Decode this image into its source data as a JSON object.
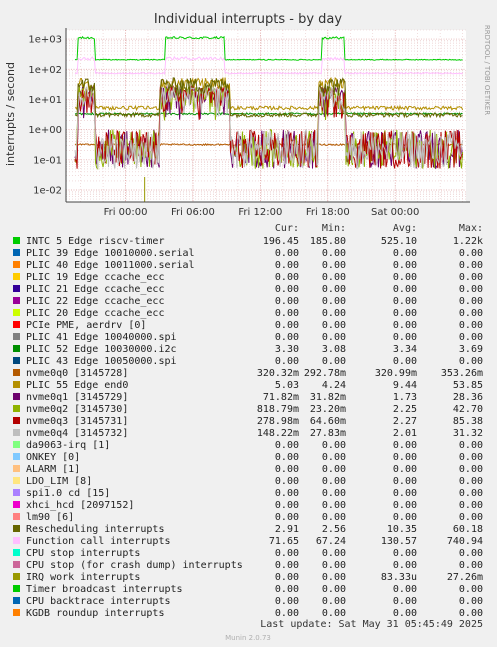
{
  "chart_data": {
    "type": "line",
    "title": "Individual interrupts - by day",
    "ylabel": "interrupts / second",
    "y_scale": "log",
    "ylim": [
      0.004,
      2000
    ],
    "y_ticks": [
      {
        "value": 1000,
        "label": "1e+03"
      },
      {
        "value": 100,
        "label": "1e+02"
      },
      {
        "value": 10,
        "label": "1e+01"
      },
      {
        "value": 1,
        "label": "1e+00"
      },
      {
        "value": 0.1,
        "label": "1e-01"
      },
      {
        "value": 0.01,
        "label": "1e-02"
      }
    ],
    "x_range_hours": [
      -5.3,
      30.3
    ],
    "x_ticks": [
      {
        "hour": 0,
        "label": "Fri 00:00"
      },
      {
        "hour": 6,
        "label": "Fri 06:00"
      },
      {
        "hour": 12,
        "label": "Fri 12:00"
      },
      {
        "hour": 18,
        "label": "Fri 18:00"
      },
      {
        "hour": 24,
        "label": "Sat 00:00"
      }
    ],
    "grid": true,
    "side_label": "RRDTOOL / TOBI OETIKER",
    "legend_header": {
      "cur": "Cur:",
      "min": "Min:",
      "avg": "Avg:",
      "max": "Max:"
    },
    "series": [
      {
        "name": "INTC   5 Edge      riscv-timer",
        "color": "#00cc00",
        "cur": "196.45",
        "min": "185.80",
        "avg": "525.10",
        "max": "1.22k",
        "shape": "timer"
      },
      {
        "name": "PLIC  39 Edge      10010000.serial",
        "color": "#0066b3",
        "cur": "0.00",
        "min": "0.00",
        "avg": "0.00",
        "max": "0.00"
      },
      {
        "name": "PLIC  40 Edge      10011000.serial",
        "color": "#ff8000",
        "cur": "0.00",
        "min": "0.00",
        "avg": "0.00",
        "max": "0.00"
      },
      {
        "name": "PLIC  19 Edge      ccache_ecc",
        "color": "#ffcc00",
        "cur": "0.00",
        "min": "0.00",
        "avg": "0.00",
        "max": "0.00"
      },
      {
        "name": "PLIC  21 Edge      ccache_ecc",
        "color": "#330099",
        "cur": "0.00",
        "min": "0.00",
        "avg": "0.00",
        "max": "0.00"
      },
      {
        "name": "PLIC  22 Edge      ccache_ecc",
        "color": "#990099",
        "cur": "0.00",
        "min": "0.00",
        "avg": "0.00",
        "max": "0.00"
      },
      {
        "name": "PLIC  20 Edge      ccache_ecc",
        "color": "#ccff00",
        "cur": "0.00",
        "min": "0.00",
        "avg": "0.00",
        "max": "0.00"
      },
      {
        "name": "PCIe PME, aerdrv [0]",
        "color": "#ff0000",
        "cur": "0.00",
        "min": "0.00",
        "avg": "0.00",
        "max": "0.00"
      },
      {
        "name": "PLIC  41 Edge      10040000.spi",
        "color": "#808080",
        "cur": "0.00",
        "min": "0.00",
        "avg": "0.00",
        "max": "0.00"
      },
      {
        "name": "PLIC  52 Edge      10030000.i2c",
        "color": "#008f00",
        "cur": "3.30",
        "min": "3.08",
        "avg": "3.34",
        "max": "3.69",
        "shape": "i2c"
      },
      {
        "name": "PLIC  43 Edge      10050000.spi",
        "color": "#00487d",
        "cur": "0.00",
        "min": "0.00",
        "avg": "0.00",
        "max": "0.00"
      },
      {
        "name": "nvme0q0 [3145728]",
        "color": "#b35a00",
        "cur": "320.32m",
        "min": "292.78m",
        "avg": "320.99m",
        "max": "353.26m",
        "shape": "flat03"
      },
      {
        "name": "PLIC  55 Edge      end0",
        "color": "#b38f00",
        "cur": "5.03",
        "min": "4.24",
        "avg": "9.44",
        "max": "53.85",
        "shape": "end0"
      },
      {
        "name": "nvme0q1 [3145729]",
        "color": "#6b006b",
        "cur": "71.82m",
        "min": "31.82m",
        "avg": "1.73",
        "max": "28.36",
        "shape": "nvme"
      },
      {
        "name": "nvme0q2 [3145730]",
        "color": "#8fb300",
        "cur": "818.79m",
        "min": "23.20m",
        "avg": "2.25",
        "max": "42.70",
        "shape": "nvme"
      },
      {
        "name": "nvme0q3 [3145731]",
        "color": "#b30000",
        "cur": "278.98m",
        "min": "64.60m",
        "avg": "2.27",
        "max": "85.38",
        "shape": "nvme"
      },
      {
        "name": "nvme0q4 [3145732]",
        "color": "#bebebe",
        "cur": "148.22m",
        "min": "27.83m",
        "avg": "2.01",
        "max": "31.32",
        "shape": "nvme"
      },
      {
        "name": "da9063-irq [1]",
        "color": "#80ff80",
        "cur": "0.00",
        "min": "0.00",
        "avg": "0.00",
        "max": "0.00"
      },
      {
        "name": "ONKEY [0]",
        "color": "#80c9ff",
        "cur": "0.00",
        "min": "0.00",
        "avg": "0.00",
        "max": "0.00"
      },
      {
        "name": "ALARM [1]",
        "color": "#ffc080",
        "cur": "0.00",
        "min": "0.00",
        "avg": "0.00",
        "max": "0.00"
      },
      {
        "name": "LDO_LIM [8]",
        "color": "#ffe680",
        "cur": "0.00",
        "min": "0.00",
        "avg": "0.00",
        "max": "0.00"
      },
      {
        "name": "spi1.0 cd [15]",
        "color": "#aa80ff",
        "cur": "0.00",
        "min": "0.00",
        "avg": "0.00",
        "max": "0.00"
      },
      {
        "name": "xhci_hcd [2097152]",
        "color": "#ee00cc",
        "cur": "0.00",
        "min": "0.00",
        "avg": "0.00",
        "max": "0.00"
      },
      {
        "name": "lm90 [6]",
        "color": "#ff8080",
        "cur": "0.00",
        "min": "0.00",
        "avg": "0.00",
        "max": "0.00"
      },
      {
        "name": "Rescheduling interrupts",
        "color": "#666600",
        "cur": "2.91",
        "min": "2.56",
        "avg": "10.35",
        "max": "60.18",
        "shape": "resched"
      },
      {
        "name": "Function call interrupts",
        "color": "#ffbfff",
        "cur": "71.65",
        "min": "67.24",
        "avg": "130.57",
        "max": "740.94",
        "shape": "funccall"
      },
      {
        "name": "CPU stop interrupts",
        "color": "#00ffcc",
        "cur": "0.00",
        "min": "0.00",
        "avg": "0.00",
        "max": "0.00"
      },
      {
        "name": "CPU stop (for crash dump) interrupts",
        "color": "#cc6699",
        "cur": "0.00",
        "min": "0.00",
        "avg": "0.00",
        "max": "0.00"
      },
      {
        "name": "IRQ work interrupts",
        "color": "#999900",
        "cur": "0.00",
        "min": "0.00",
        "avg": "83.33u",
        "max": "27.26m",
        "shape": "irqwork"
      },
      {
        "name": "Timer broadcast interrupts",
        "color": "#00cc00",
        "cur": "0.00",
        "min": "0.00",
        "avg": "0.00",
        "max": "0.00"
      },
      {
        "name": "CPU backtrace interrupts",
        "color": "#0066b3",
        "cur": "0.00",
        "min": "0.00",
        "avg": "0.00",
        "max": "0.00"
      },
      {
        "name": "KGDB roundup interrupts",
        "color": "#ff8000",
        "cur": "0.00",
        "min": "0.00",
        "avg": "0.00",
        "max": "0.00"
      }
    ],
    "last_update": "Last update: Sat May 31 05:45:49 2025",
    "footer": "Munin 2.0.73"
  }
}
